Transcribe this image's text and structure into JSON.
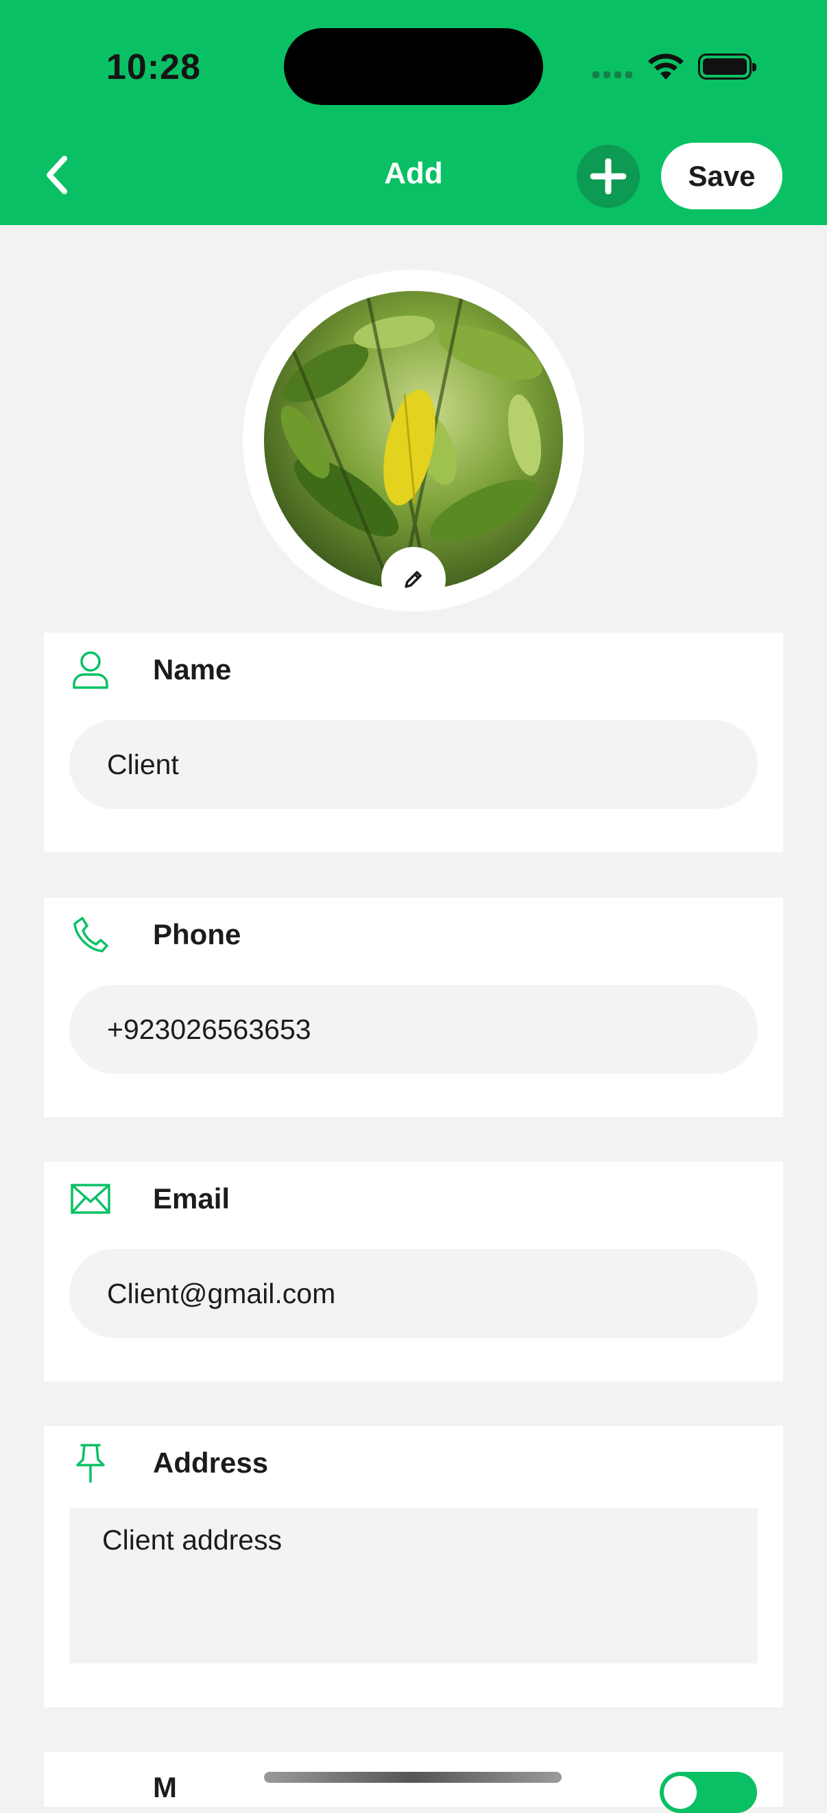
{
  "status_bar": {
    "time": "10:28"
  },
  "nav": {
    "title": "Add",
    "save_label": "Save"
  },
  "fields": {
    "name": {
      "label": "Name",
      "value": "Client"
    },
    "phone": {
      "label": "Phone",
      "value": "+923026563653"
    },
    "email": {
      "label": "Email",
      "value": "Client@gmail.com"
    },
    "address": {
      "label": "Address",
      "value": "Client address"
    }
  },
  "next_section": {
    "label_partial": "M",
    "toggle_on": true
  },
  "colors": {
    "primary": "#0ac064",
    "dark_green": "#0d9a52",
    "field_bg": "#f3f3f3"
  },
  "icons": [
    "chevron-left-icon",
    "plus-icon",
    "pencil-icon",
    "person-icon",
    "phone-icon",
    "envelope-icon",
    "pin-icon"
  ]
}
